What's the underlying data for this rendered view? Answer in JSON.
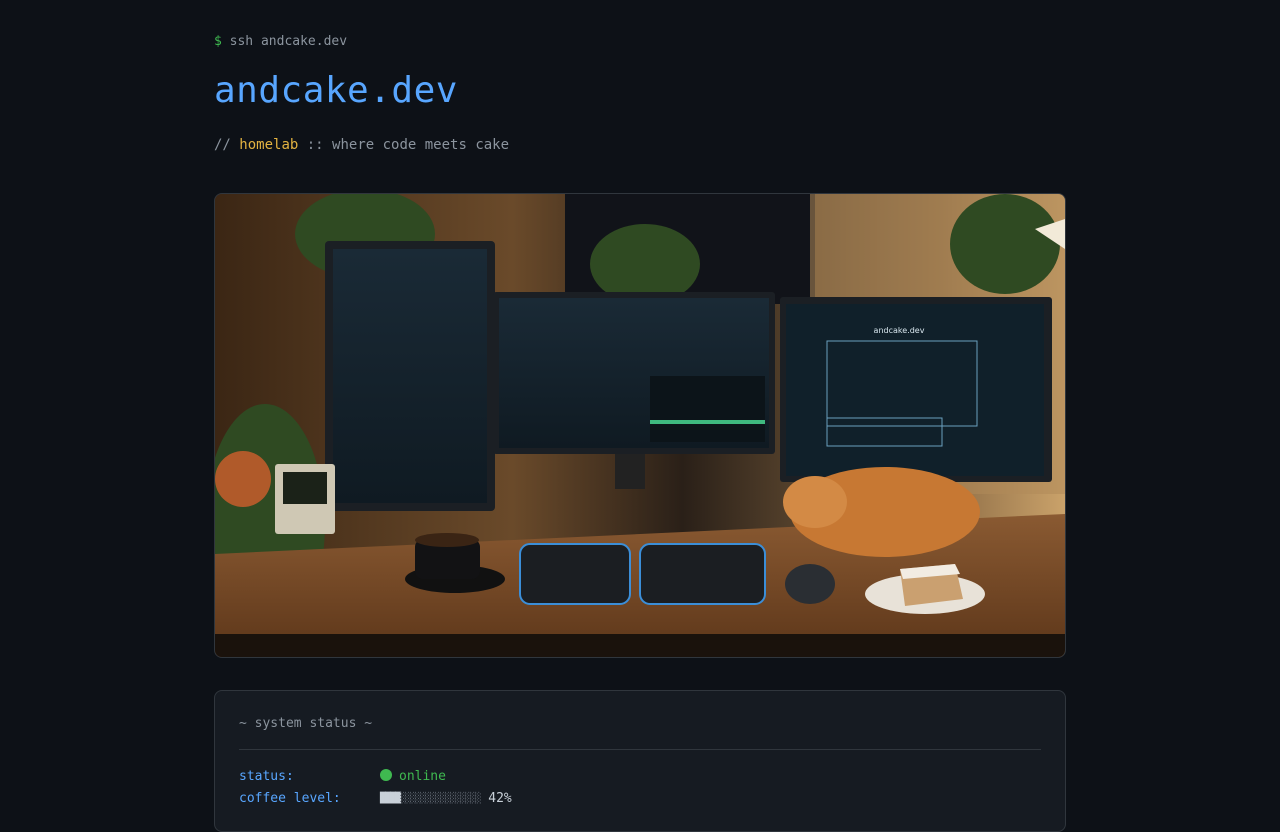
{
  "prompt": {
    "symbol": "$",
    "command": "ssh andcake.dev"
  },
  "site": {
    "title": "andcake.dev"
  },
  "tagline": {
    "prefix": "//",
    "highlight": "homelab",
    "rest": ":: where code meets cake"
  },
  "photo": {
    "alt": "desk setup with three monitors, a cat and cake",
    "screen_title": "andcake.dev"
  },
  "status_card": {
    "heading": "~ system status ~",
    "rows": [
      {
        "key": "status:",
        "value": "online",
        "icon": "status-dot-icon"
      },
      {
        "key": "coffee level:",
        "value": "42%",
        "level": 0.42
      }
    ]
  },
  "colors": {
    "background": "#0d1117",
    "accent": "#58a6ff",
    "highlight": "#e3b341",
    "online": "#3fb950",
    "muted": "#8b949e"
  }
}
